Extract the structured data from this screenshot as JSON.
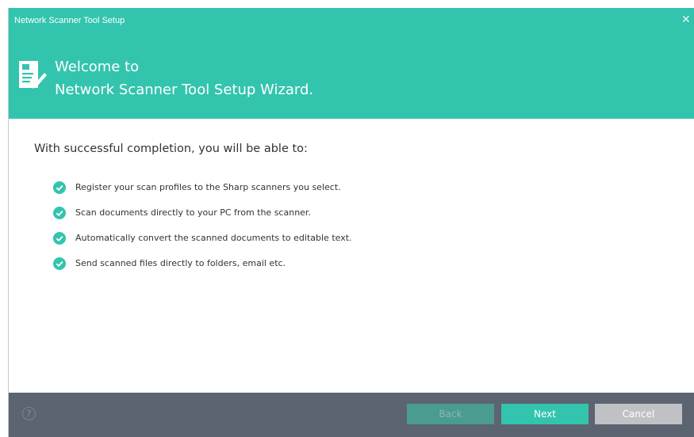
{
  "window": {
    "title": "Network Scanner Tool Setup",
    "close_glyph": "✕"
  },
  "header": {
    "welcome_line1": "Welcome to",
    "welcome_line2": "Network Scanner Tool Setup Wizard.",
    "icon": "document-edit-icon"
  },
  "content": {
    "intro": "With successful completion, you will be able to:",
    "features": [
      "Register your scan profiles to the Sharp scanners you select.",
      "Scan documents directly to your PC from the scanner.",
      "Automatically convert the scanned documents to editable text.",
      "Send scanned files directly to folders, email etc."
    ],
    "feature_icon": "check-circle-icon"
  },
  "footer": {
    "help_glyph": "?",
    "back_label": "Back",
    "next_label": "Next",
    "cancel_label": "Cancel"
  },
  "colors": {
    "accent": "#33c4ae",
    "footer_bg": "#5c6471",
    "back_disabled": "#4a9b92",
    "cancel_bg": "#bfc1c4",
    "text": "#333333"
  }
}
